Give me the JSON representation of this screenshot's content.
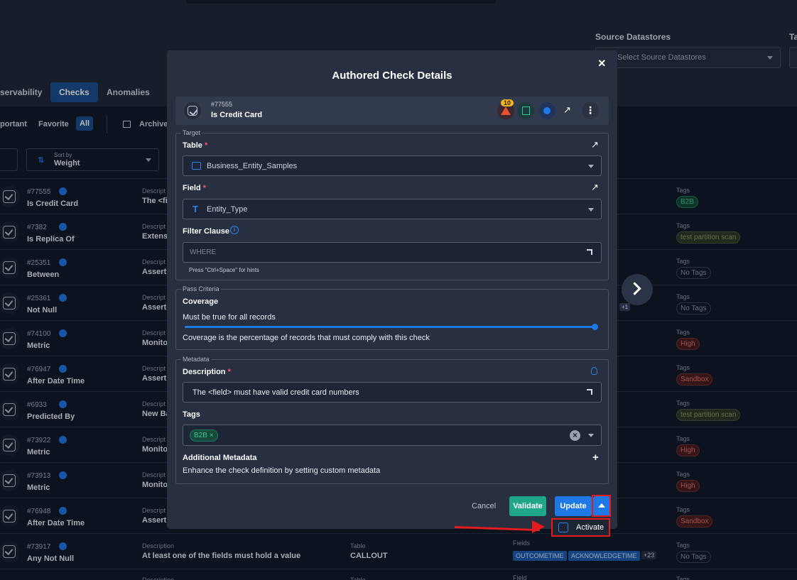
{
  "background": {
    "source_datastores_label": "Source Datastores",
    "source_datastores_placeholder": "Select Source Datastores",
    "ta_label": "Ta",
    "tabs": [
      "servability",
      "Checks",
      "Anomalies"
    ],
    "filters": [
      "portant",
      "Favorite",
      "All"
    ],
    "archive_label": "Archive",
    "sort_by_label": "Sort by",
    "sort_by_value": "Weight",
    "rows": [
      {
        "id": "#77555",
        "name": "Is Credit Card",
        "desc_label": "Descript",
        "desc": "The <fi",
        "tags_label": "Tags",
        "tag": "B2B",
        "tag_style": "green"
      },
      {
        "id": "#7382",
        "name": "Is Replica Of",
        "desc_label": "Descript",
        "desc": "Extensi",
        "tags_label": "Tags",
        "tag": "test partition scan",
        "tag_style": "olive"
      },
      {
        "id": "#25351",
        "name": "Between",
        "desc_label": "Descript",
        "desc": "Asserts",
        "tags_label": "Tags",
        "tag": "No Tags",
        "tag_style": "gray"
      },
      {
        "id": "#25361",
        "name": "Not Null",
        "desc_label": "Descript",
        "desc": "Asserts",
        "tags_label": "Tags",
        "tag": "No Tags",
        "tag_style": "gray"
      },
      {
        "id": "#74100",
        "name": "Metric",
        "desc_label": "Descript",
        "desc": "Monito",
        "tags_label": "Tags",
        "tag": "High",
        "tag_style": "red"
      },
      {
        "id": "#76947",
        "name": "After Date Time",
        "desc_label": "Descript",
        "desc": "Assert",
        "tags_label": "Tags",
        "tag": "Sandbox",
        "tag_style": "red"
      },
      {
        "id": "#6933",
        "name": "Predicted By",
        "desc_label": "Descript",
        "desc": "New Ba",
        "tags_label": "Tags",
        "tag": "test partition scan",
        "tag_style": "olive"
      },
      {
        "id": "#73922",
        "name": "Metric",
        "desc_label": "Descript",
        "desc": "Monito",
        "tags_label": "Tags",
        "tag": "High",
        "tag_style": "red"
      },
      {
        "id": "#73913",
        "name": "Metric",
        "desc_label": "Descript",
        "desc": "Monito",
        "tags_label": "Tags",
        "tag": "High",
        "tag_style": "red"
      },
      {
        "id": "#76948",
        "name": "After Date Time",
        "desc_label": "Descript",
        "desc": "Assert",
        "tags_label": "Tags",
        "tag": "Sandbox",
        "tag_style": "red"
      },
      {
        "id": "#73917",
        "name": "Any Not Null",
        "desc_label": "Description",
        "desc": "At least one of the fields must hold a value",
        "tags_label": "Tags",
        "tag": "No Tags",
        "tag_style": "gray",
        "table_label": "Table",
        "table": "CALLOUT",
        "fields_label": "Fields",
        "fields": [
          "OUTCOMETIME",
          "ACKNOWLEDGETIME"
        ],
        "fields_more": "+23"
      }
    ],
    "last_row": {
      "desc_label": "Description",
      "table_label": "Table",
      "fields_label": "Field",
      "tags_label": "Tags"
    },
    "plus_one": "+1"
  },
  "modal": {
    "title": "Authored Check Details",
    "check_id": "#77555",
    "check_name": "Is Credit Card",
    "alert_count": "10",
    "target_legend": "Target",
    "table_label": "Table",
    "table_value": "Business_Entity_Samples",
    "field_label": "Field",
    "field_value": "Entity_Type",
    "filter_label": "Filter Clause",
    "filter_placeholder": "WHERE",
    "filter_hint": "Press \"Ctrl+Space\" for hints",
    "pass_legend": "Pass Criteria",
    "coverage_label": "Coverage",
    "coverage_text": "Must be true for all records",
    "coverage_value": 1.0,
    "coverage_help": "Coverage is the percentage of records that must comply with this check",
    "metadata_legend": "Metadata",
    "description_label": "Description",
    "description_value": "The <field> must have valid credit card numbers",
    "tags_label": "Tags",
    "tags": [
      "B2B"
    ],
    "additional_label": "Additional Metadata",
    "additional_help": "Enhance the check definition by setting custom metadata",
    "cancel": "Cancel",
    "validate": "Validate",
    "update": "Update",
    "activate": "Activate"
  },
  "colors": {
    "accent": "#1e78e6",
    "validate": "#1fa58a",
    "highlight": "#e41b1b"
  }
}
